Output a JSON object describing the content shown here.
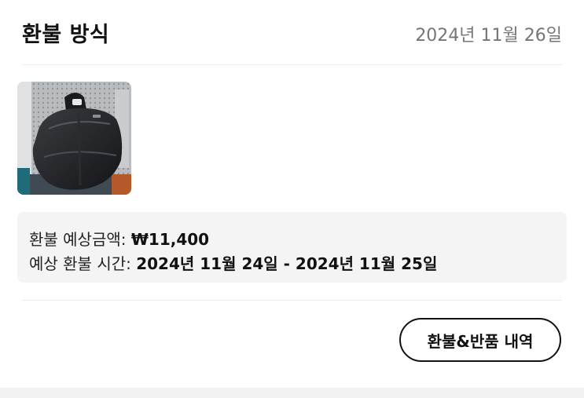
{
  "refund": {
    "title": "환불 방식",
    "date": "2024년 11월 26일"
  },
  "product": {
    "image_icon": "bag-photo-icon"
  },
  "info": {
    "amount_label": "환불 예상금액: ",
    "amount_value": "₩11,400",
    "time_label": "예상 환불 시간: ",
    "time_value": "2024년 11월 24일 - 2024년 11월 25일"
  },
  "actions": {
    "history_button": "환불&반품 내역"
  },
  "colors": {
    "info_bg": "#f4f4f4",
    "date_text": "#757575",
    "button_border": "#111111"
  }
}
